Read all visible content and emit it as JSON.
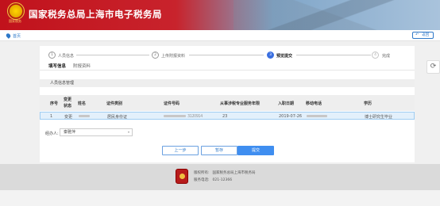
{
  "header": {
    "site_title": "国家税务总局上海市电子税务局",
    "emblem_caption": "国家税务"
  },
  "breadcrumb": {
    "home_label": "首页"
  },
  "back_button": {
    "label": "返回",
    "icon": "undo-arrow-icon"
  },
  "side_tool": {
    "icon": "refresh-icon"
  },
  "steps": [
    {
      "number": "1",
      "label": "人员信息",
      "state": "done"
    },
    {
      "number": "2",
      "label": "上传附报资料",
      "state": "done"
    },
    {
      "number": "3",
      "label": "预览提交",
      "state": "active"
    },
    {
      "number": "4",
      "label": "完成",
      "state": "todo"
    }
  ],
  "tabs": [
    {
      "label": "填写信息",
      "active": true
    },
    {
      "label": "附报资料",
      "active": false
    }
  ],
  "section": {
    "title": "人员信息管理"
  },
  "table": {
    "headers": {
      "index": "序号",
      "change_status_line1": "变更",
      "change_status_line2": "状态",
      "name": "姓名",
      "id_type": "证件类别",
      "id_number": "证件号码",
      "years": "从事涉税专业服务年限",
      "join_date": "入职日期",
      "mobile": "移动电话",
      "education": "学历"
    },
    "rows": [
      {
        "index": "1",
        "change_status": "变更",
        "name": "",
        "id_type": "居民身份证",
        "id_number_visible": "3120914",
        "years": "23",
        "join_date": "2019-07-26",
        "mobile": "",
        "education": "博士研究生毕业"
      }
    ]
  },
  "agent": {
    "label": "经办人:",
    "value": "秦雅萍"
  },
  "buttons": {
    "prev": "上一步",
    "save": "暂存",
    "submit": "提交"
  },
  "footer": {
    "copyright_key": "版权所有:",
    "copyright_value": "国家税务总局上海市税务局",
    "phone_key": "服务电话:",
    "phone_value": "021-12366"
  },
  "colors": {
    "brand_red": "#c1121c",
    "accent_blue": "#3a6fe0",
    "button_blue": "#3f8ef0"
  }
}
